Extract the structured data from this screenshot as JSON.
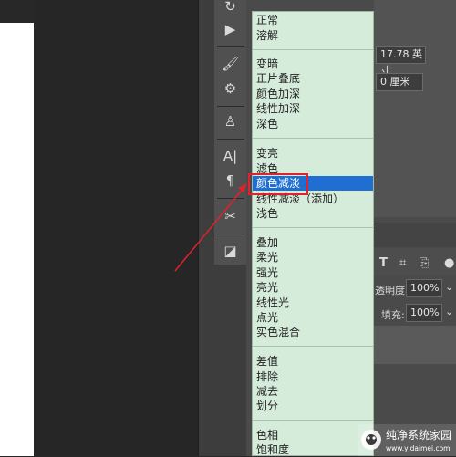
{
  "units": {
    "width_value": "17.78 英寸",
    "offset_value": "0 厘米"
  },
  "layers": {
    "opacity_label": "透明度:",
    "opacity_value": "100%",
    "fill_label": "填充:",
    "fill_value": "100%"
  },
  "blend_menu": {
    "items": [
      "正常",
      "溶解",
      "变暗",
      "正片叠底",
      "颜色加深",
      "线性加深",
      "深色",
      "变亮",
      "滤色",
      "颜色减淡",
      "线性减淡（添加）",
      "浅色",
      "叠加",
      "柔光",
      "强光",
      "亮光",
      "线性光",
      "点光",
      "实色混合",
      "差值",
      "排除",
      "减去",
      "划分",
      "色相",
      "饱和度"
    ],
    "selected": "颜色减淡"
  },
  "watermark": {
    "title": "纯净系统家园",
    "url": "www.yidaimei.com"
  },
  "colors": {
    "menu_bg": "#d6ecdb",
    "selected_bg": "#1e6fd1",
    "annotation_red": "#e1212b"
  }
}
